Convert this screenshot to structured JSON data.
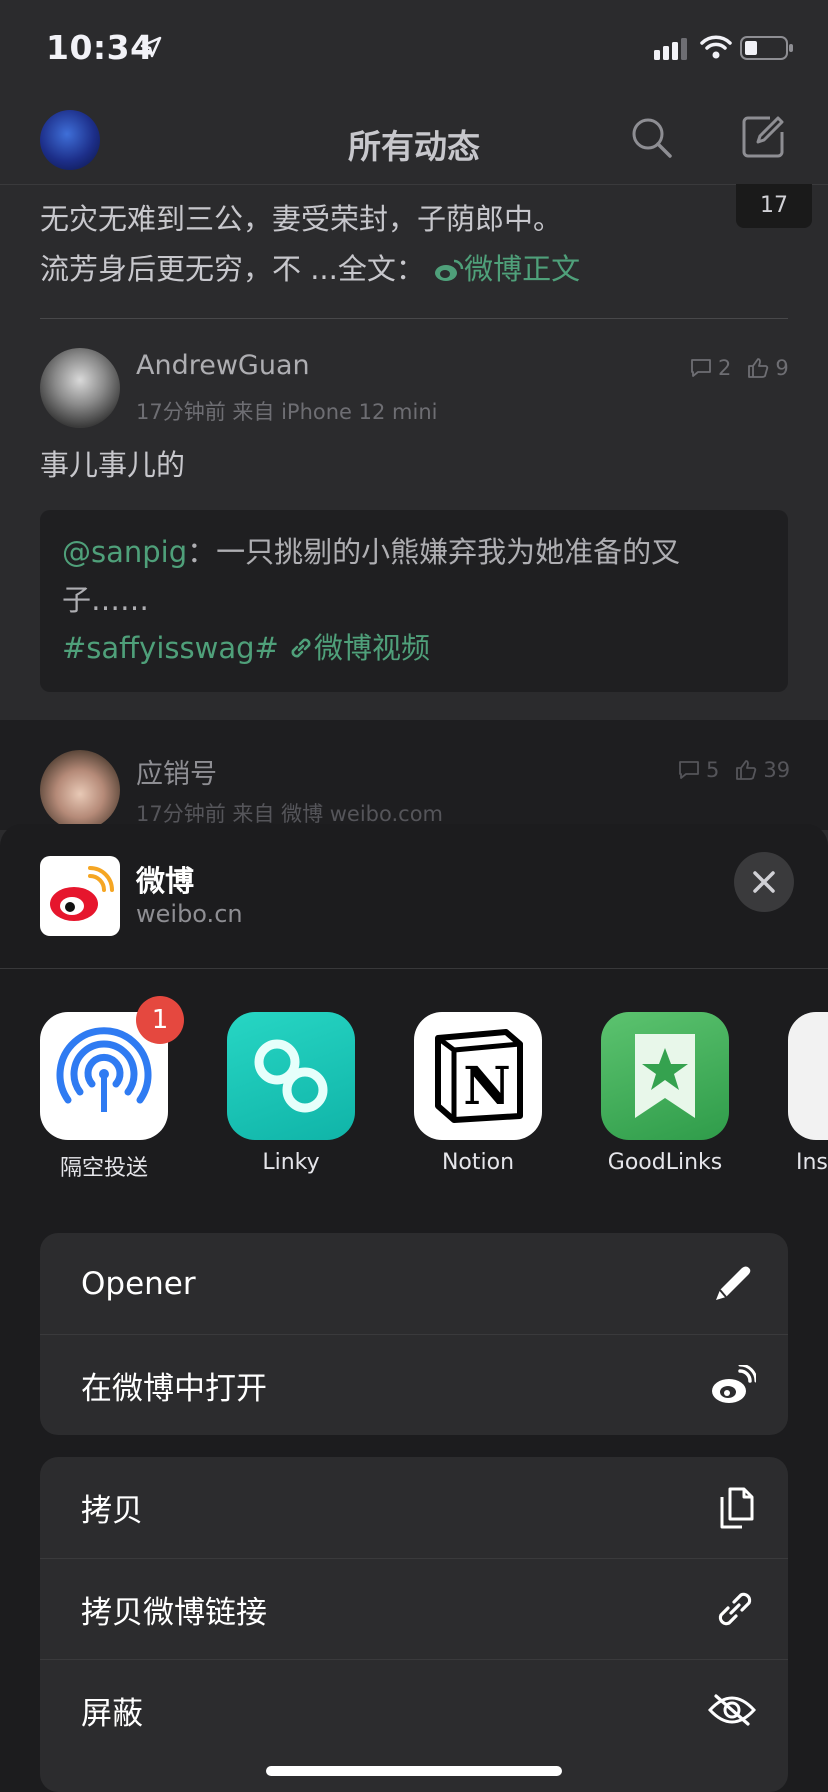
{
  "status": {
    "time": "10:34"
  },
  "nav": {
    "title": "所有动态"
  },
  "feed": {
    "count_chip": "17",
    "post0": {
      "line1": "无灾无难到三公，妻受荣封，子荫郎中。",
      "line2_text": "流芳身后更无穷，不 ...全文：",
      "line2_link": "微博正文"
    },
    "post1": {
      "user": "AndrewGuan",
      "meta": "17分钟前 来自 iPhone 12 mini",
      "comments": "2",
      "likes": "9",
      "text": "事儿事儿的",
      "quote_mention": "@sanpig",
      "quote_line1": "：一只挑剔的小熊嫌弃我为她准备的叉",
      "quote_line2": "子……",
      "quote_tag": "#saffyisswag#",
      "quote_link": "微博视频"
    },
    "post2": {
      "user": "应销号",
      "meta": "17分钟前 来自 微博 weibo.com",
      "comments": "5",
      "likes": "39"
    }
  },
  "sheet": {
    "site_name": "微博",
    "site_url": "weibo.cn",
    "apps": [
      {
        "label": "隔空投送",
        "badge": "1"
      },
      {
        "label": "Linky"
      },
      {
        "label": "Notion"
      },
      {
        "label": "GoodLinks"
      },
      {
        "label": "Inst"
      }
    ],
    "group1": [
      {
        "label": "Opener",
        "icon": "pencil-icon"
      },
      {
        "label": "在微博中打开",
        "icon": "weibo-icon"
      }
    ],
    "group2": [
      {
        "label": "拷贝",
        "icon": "copy-icon"
      },
      {
        "label": "拷贝微博链接",
        "icon": "link-icon"
      },
      {
        "label": "屏蔽",
        "icon": "eye-slash-icon"
      }
    ]
  },
  "colors": {
    "accent_green": "#4fa07a",
    "badge_red": "#e5483f",
    "linky": "#1ec9b8",
    "goodlinks": "#3aa55a"
  }
}
